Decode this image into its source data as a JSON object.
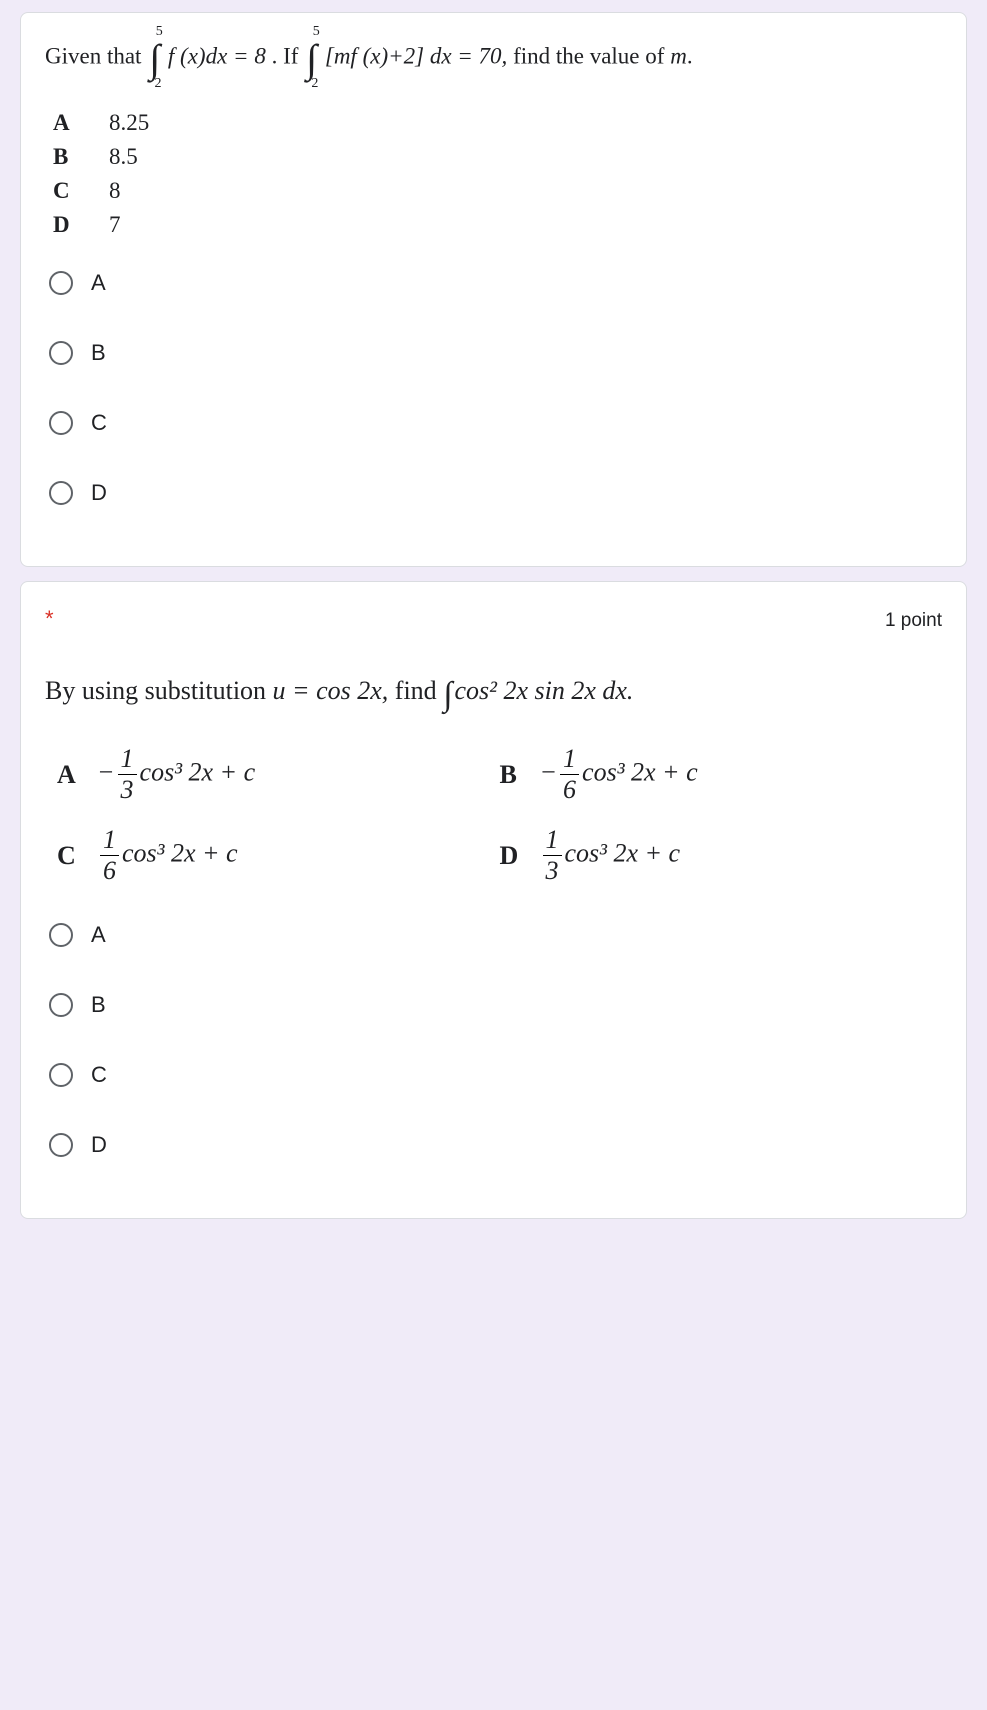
{
  "question1": {
    "prompt_prefix": "Given that ",
    "integral1": {
      "upper": "5",
      "lower": "2",
      "body": "f (x)dx = 8"
    },
    "middle": ". If ",
    "integral2": {
      "upper": "5",
      "lower": "2",
      "body": "[mf (x)+2] dx = 70,"
    },
    "prompt_suffix": " find the value of m.",
    "answers": [
      {
        "label": "A",
        "value": "8.25"
      },
      {
        "label": "B",
        "value": "8.5"
      },
      {
        "label": "C",
        "value": "8"
      },
      {
        "label": "D",
        "value": "7"
      }
    ],
    "options": [
      "A",
      "B",
      "C",
      "D"
    ]
  },
  "question2": {
    "required_marker": "*",
    "points": "1 point",
    "prompt_prefix": "By using substitution ",
    "prompt_sub": "u = cos 2x,",
    "prompt_mid": " find ",
    "prompt_integral_body": "cos² 2x sin 2x dx.",
    "answers": [
      {
        "label": "A",
        "sign": "−",
        "num": "1",
        "den": "3",
        "rest": "cos³ 2x + c"
      },
      {
        "label": "B",
        "sign": "−",
        "num": "1",
        "den": "6",
        "rest": "cos³ 2x + c"
      },
      {
        "label": "C",
        "sign": "",
        "num": "1",
        "den": "6",
        "rest": "cos³ 2x + c"
      },
      {
        "label": "D",
        "sign": "",
        "num": "1",
        "den": "3",
        "rest": "cos³ 2x + c"
      }
    ],
    "options": [
      "A",
      "B",
      "C",
      "D"
    ]
  }
}
